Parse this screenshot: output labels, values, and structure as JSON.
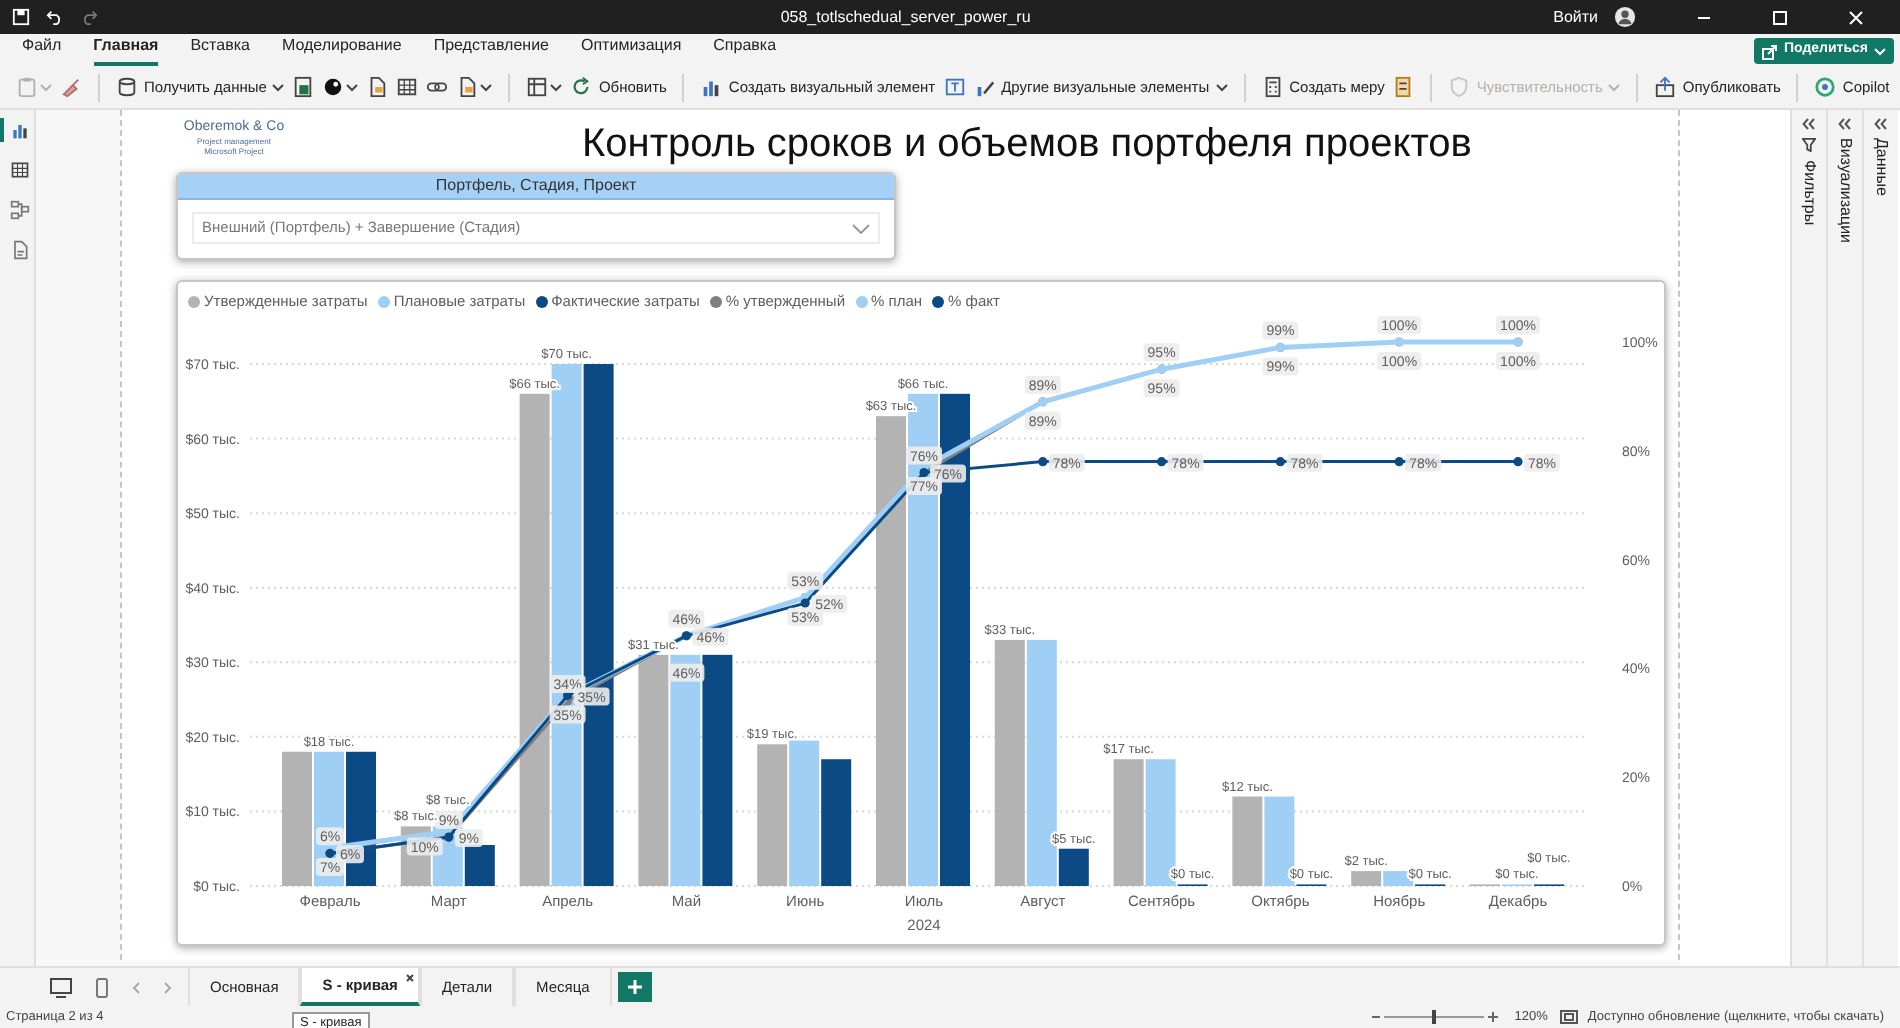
{
  "window": {
    "title": "058_totlschedual_server_power_ru",
    "sign_in": "Войти"
  },
  "ribbon_tabs": [
    {
      "label": "Файл",
      "selected": false
    },
    {
      "label": "Главная",
      "selected": true
    },
    {
      "label": "Вставка",
      "selected": false
    },
    {
      "label": "Моделирование",
      "selected": false
    },
    {
      "label": "Представление",
      "selected": false
    },
    {
      "label": "Оптимизация",
      "selected": false
    },
    {
      "label": "Справка",
      "selected": false
    }
  ],
  "share_button": "Поделиться",
  "toolbar": [
    {
      "label": "Получить данные",
      "dropdown": true,
      "disabled": false
    },
    {
      "label": "Обновить",
      "dropdown": false,
      "disabled": false
    },
    {
      "label": "Создать визуальный элемент",
      "dropdown": false,
      "disabled": false
    },
    {
      "label": "Другие визуальные элементы",
      "dropdown": true,
      "disabled": false
    },
    {
      "label": "Создать меру",
      "dropdown": false,
      "disabled": false
    },
    {
      "label": "Чувствительность",
      "dropdown": true,
      "disabled": true
    },
    {
      "label": "Опубликовать",
      "dropdown": false,
      "disabled": false
    },
    {
      "label": "Copilot",
      "dropdown": false,
      "disabled": false
    }
  ],
  "views": [
    {
      "selected": true
    },
    {
      "selected": false
    },
    {
      "selected": false
    },
    {
      "selected": false
    }
  ],
  "report": {
    "logo": {
      "name": "Oberemok & Co",
      "line_1": "Project management",
      "line_2": "Microsoft Project"
    },
    "title": "Контроль сроков и объемов портфеля проектов",
    "slicer": {
      "header": "Портфель, Стадия, Проект",
      "value": "Внешний (Портфель) + Завершение (Стадия)"
    }
  },
  "chart": {
    "chart_data": {
      "type": "bar",
      "xlabel": "2024",
      "grid": true,
      "ylim": [
        0,
        70
      ],
      "categories": [
        "Февраль",
        "Март",
        "Апрель",
        "Май",
        "Июнь",
        "Июль",
        "Август",
        "Сентябрь",
        "Октябрь",
        "Ноябрь",
        "Декабрь"
      ],
      "yticks": [
        {
          "value": 0,
          "label": "$0 тыс."
        },
        {
          "value": 10,
          "label": "$10 тыс."
        },
        {
          "value": 20,
          "label": "$20 тыс."
        },
        {
          "value": 30,
          "label": "$30 тыс."
        },
        {
          "value": 40,
          "label": "$40 тыс."
        },
        {
          "value": 50,
          "label": "$50 тыс."
        },
        {
          "value": 60,
          "label": "$60 тыс."
        },
        {
          "value": 70,
          "label": "$70 тыс."
        }
      ],
      "series": [
        {
          "name": "Утвержденные затраты",
          "color": "#b3b3b3",
          "values": [
            18,
            8,
            66,
            31,
            19,
            63,
            33,
            17,
            12,
            2,
            0
          ],
          "value_labels": [
            null,
            "$8 тыс.",
            "$66 тыс.",
            "$31 тыс.",
            "$19 тыс.",
            "$63 тыс.",
            "$33 тыс.",
            "$17 тыс.",
            "$12 тыс.",
            "$2 тыс.",
            null
          ]
        },
        {
          "name": "Плановые затраты",
          "color": "#a0cff5",
          "values": [
            18,
            8,
            70,
            31,
            19.5,
            66,
            33,
            17,
            12,
            2,
            0
          ],
          "value_labels": [
            "$18 тыс.",
            "$8 тыс.",
            "$70 тыс.",
            null,
            null,
            "$66 тыс.",
            null,
            null,
            null,
            null,
            "$0 тыс."
          ]
        },
        {
          "name": "Фактические затраты",
          "color": "#0b4a84",
          "values": [
            18,
            5.5,
            70,
            31,
            17,
            66,
            5,
            0,
            0,
            0,
            0
          ],
          "value_labels": [
            null,
            null,
            null,
            null,
            null,
            null,
            "$5 тыс.",
            "$0 тыс.",
            "$0 тыс.",
            "$0 тыс.",
            "$0 тыс."
          ]
        }
      ]
    }
  },
  "line_chart": {
    "chart_data": {
      "type": "line",
      "ylim": [
        0,
        100
      ],
      "yticks": [
        {
          "value": 0,
          "label": "0%"
        },
        {
          "value": 20,
          "label": "20%"
        },
        {
          "value": 40,
          "label": "40%"
        },
        {
          "value": 60,
          "label": "60%"
        },
        {
          "value": 80,
          "label": "80%"
        },
        {
          "value": 100,
          "label": "100%"
        }
      ],
      "series": [
        {
          "name": "% утвержденный",
          "color": "#7f7f7f",
          "marker": "o",
          "values": [
            6,
            9,
            34,
            46,
            53,
            76,
            89,
            95,
            99,
            100,
            100
          ],
          "value_labels": [
            "6%",
            "9%",
            "34%",
            "46%",
            "53%",
            "76%",
            "89%",
            "95%",
            "99%",
            "100%",
            "100%"
          ]
        },
        {
          "name": "% план",
          "color": "#a0cff5",
          "marker": "o",
          "values": [
            7,
            10,
            35,
            46,
            53,
            77,
            89,
            95,
            99,
            100,
            100
          ],
          "value_labels": [
            "7%",
            "10%",
            "35%",
            "46%",
            "53%",
            "77%",
            "89%",
            "95%",
            "99%",
            "100%",
            "100%"
          ]
        },
        {
          "name": "% факт",
          "color": "#0b4a84",
          "marker": "o",
          "values": [
            6,
            9,
            35,
            46,
            52,
            76,
            78,
            78,
            78,
            78,
            78
          ],
          "value_labels": [
            "6%",
            "9%",
            "35%",
            "46%",
            "52%",
            "76%",
            "78%",
            "78%",
            "78%",
            "78%",
            "78%"
          ]
        }
      ]
    }
  },
  "panes": [
    {
      "label": "Фильтры"
    },
    {
      "label": "Визуализации"
    },
    {
      "label": "Данные"
    }
  ],
  "pages": [
    {
      "label": "Основная",
      "selected": false
    },
    {
      "label": "S - кривая",
      "selected": true
    },
    {
      "label": "Детали",
      "selected": false
    },
    {
      "label": "Месяца",
      "selected": false
    }
  ],
  "tooltip": "S - кривая",
  "status_bar": {
    "page": "Страница 2 из 4",
    "zoom_slider": {
      "level": 0.5
    },
    "zoom": "120%",
    "update": "Доступно обновление (щелкните, чтобы скачать)"
  }
}
